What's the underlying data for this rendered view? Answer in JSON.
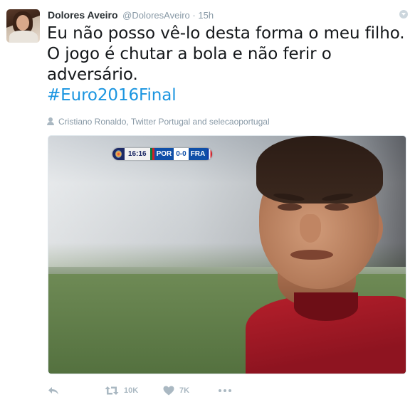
{
  "tweet": {
    "author_name": "Dolores Aveiro",
    "author_handle": "@DoloresAveiro",
    "separator": "·",
    "time": "15h",
    "text": "Eu não posso vê-lo desta forma o meu filho. O jogo é chutar a bola e não ferir o adversário.",
    "hashtag": "#Euro2016Final",
    "tagged_people": "Cristiano Ronaldo, Twitter Portugal and selecaoportugal"
  },
  "media": {
    "scorebug": {
      "clock": "16:16",
      "team_home": "POR",
      "score": "0-0",
      "team_away": "FRA"
    }
  },
  "actions": {
    "retweet_count": "10K",
    "like_count": "7K"
  },
  "icons": {
    "reply": "reply-icon",
    "retweet": "retweet-icon",
    "like": "heart-icon",
    "more": "more-icon",
    "menu": "caret-down-icon",
    "tagged": "person-icon"
  },
  "colors": {
    "hashtag": "#1b95e0",
    "muted": "#8899a6",
    "action_icon": "#aab8c2",
    "text": "#14171a"
  }
}
